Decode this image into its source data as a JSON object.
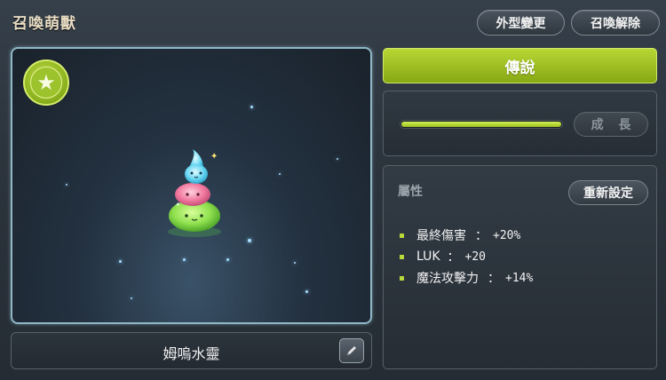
{
  "window": {
    "title": "召喚萌獸",
    "buttons": {
      "appearance_change": "外型變更",
      "release": "召喚解除"
    }
  },
  "pet": {
    "name": "姆嗚水靈",
    "grade": "傳說",
    "grade_icon": "star-icon",
    "growth": {
      "progress": 1.0,
      "button_label": "成 長"
    }
  },
  "attributes": {
    "title": "屬性",
    "reset_label": "重新設定",
    "stats": [
      {
        "name": "最終傷害",
        "sep": "：",
        "value": "+20%"
      },
      {
        "name": "LUK",
        "sep": "：",
        "value": "+20"
      },
      {
        "name": "魔法攻擊力",
        "sep": "：",
        "value": "+14%"
      }
    ]
  },
  "colors": {
    "accent_green": "#9cc22c",
    "bullet": "#b9d83a",
    "title_text": "#e8dcc4"
  }
}
